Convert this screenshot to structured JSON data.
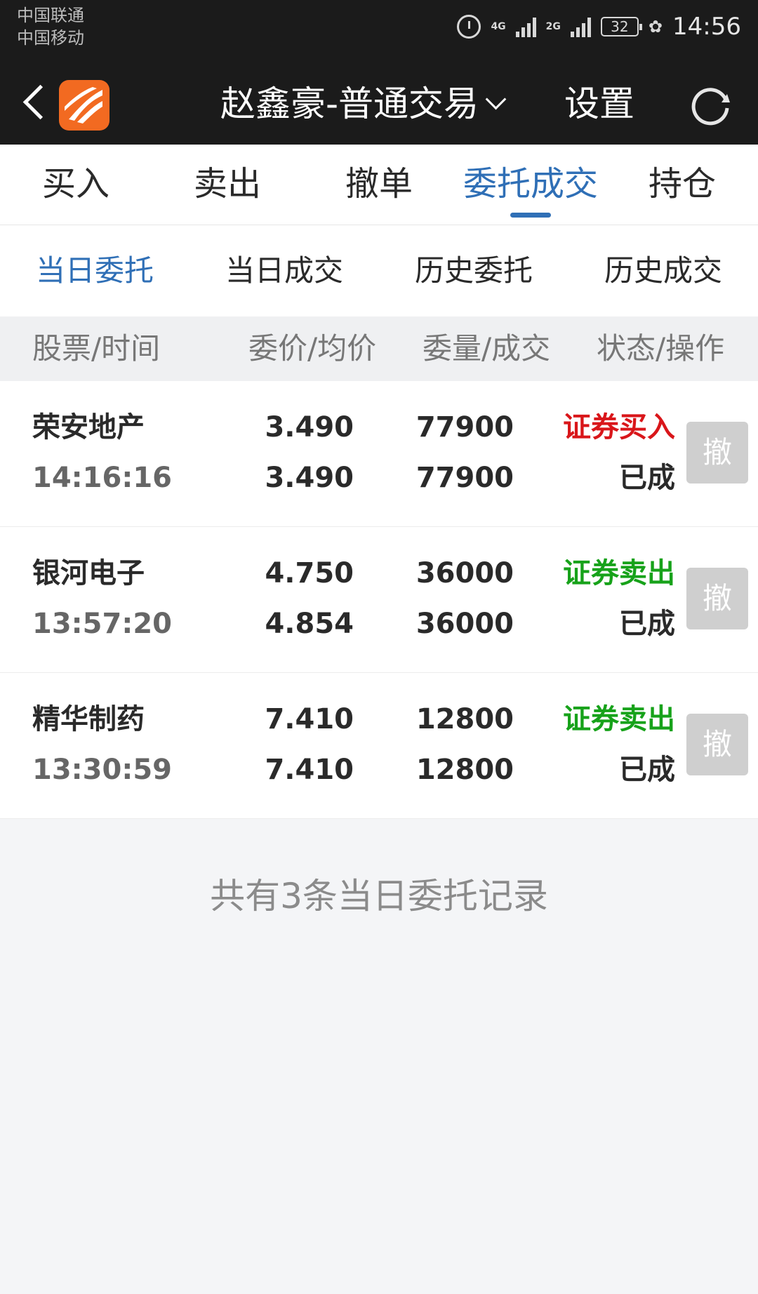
{
  "status_bar": {
    "carrier1": "中国联通",
    "carrier2": "中国移动",
    "net1": "4G",
    "net2": "2G",
    "battery": "32",
    "time": "14:56"
  },
  "titlebar": {
    "title": "赵鑫豪-普通交易",
    "settings": "设置"
  },
  "main_tabs": [
    {
      "label": "买入"
    },
    {
      "label": "卖出"
    },
    {
      "label": "撤单"
    },
    {
      "label": "委托成交",
      "active": true
    },
    {
      "label": "持仓"
    }
  ],
  "sub_tabs": [
    {
      "label": "当日委托",
      "active": true
    },
    {
      "label": "当日成交"
    },
    {
      "label": "历史委托"
    },
    {
      "label": "历史成交"
    }
  ],
  "columns": [
    "股票/时间",
    "委价/均价",
    "委量/成交",
    "状态/操作"
  ],
  "orders": [
    {
      "name": "荣安地产",
      "time": "14:16:16",
      "price": "3.490",
      "avg_price": "3.490",
      "qty": "77900",
      "filled": "77900",
      "action": "证券买入",
      "action_color": "#d9161a",
      "status": "已成",
      "cancel": "撤"
    },
    {
      "name": "银河电子",
      "time": "13:57:20",
      "price": "4.750",
      "avg_price": "4.854",
      "qty": "36000",
      "filled": "36000",
      "action": "证券卖出",
      "action_color": "#17a21a",
      "status": "已成",
      "cancel": "撤"
    },
    {
      "name": "精华制药",
      "time": "13:30:59",
      "price": "7.410",
      "avg_price": "7.410",
      "qty": "12800",
      "filled": "12800",
      "action": "证券卖出",
      "action_color": "#17a21a",
      "status": "已成",
      "cancel": "撤"
    }
  ],
  "footer": "共有3条当日委托记录",
  "colors": {
    "accent": "#2f6fb6",
    "buy": "#d9161a",
    "sell": "#17a21a",
    "header_bg": "#1b1b1b",
    "logo": "#f26a21"
  }
}
